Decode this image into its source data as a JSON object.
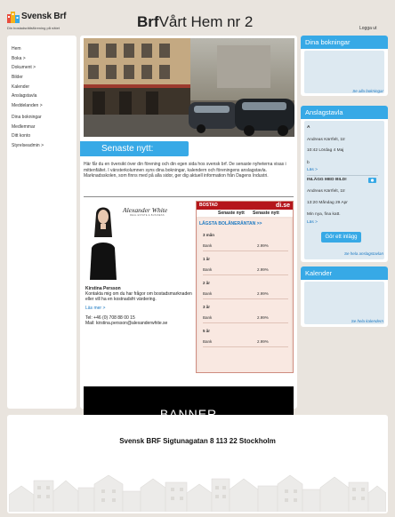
{
  "header": {
    "logo_brand": "Svensk Brf",
    "logo_tagline": "Din bostadsrättsförening på nätet",
    "site_title_bold": "Brf",
    "site_title_rest": "Vårt Hem nr 2",
    "logout": "Logga ut"
  },
  "sidebar": {
    "items": [
      {
        "label": "Hem"
      },
      {
        "label": "Boka >"
      },
      {
        "label": "Dokument >"
      },
      {
        "label": "Bilder"
      },
      {
        "label": "Kalender"
      },
      {
        "label": "Anslagstavla"
      },
      {
        "label": "Meddelanden >"
      },
      {
        "label": "Dina bokningar"
      },
      {
        "label": "Medlemmar"
      },
      {
        "label": "Ditt konto"
      },
      {
        "label": "Styrelseadmin >"
      }
    ]
  },
  "main": {
    "news_heading": "Senaste nytt:",
    "intro": "Här får du en översikt över din förening och din egen sida hos svensk brf. De senaste nyheterna visas i mittenfältet. I vänsterkolumnen syns dina bokningar, kalendern och föreningens anslagstavla. Marknadsskolen, som finns med på alla sidor, ger dig aktuell information från Dagens Industri.",
    "agent": {
      "logo": "Alexander White",
      "logo_sub": "REAL ESTATE & BUSINESS",
      "name": "Kirstina Persson",
      "description": "Kontakta mig om du har frågor om bostadsmarknaden eller vill ha en kostnadsfri värdering.",
      "more": "Läs mer >",
      "tel": "Tel: +46 (0) 708 88 00 15",
      "mail": "Mail: kirstina.persson@alexanderwhite.se"
    },
    "rates": {
      "section": "BOSTAD",
      "source": "di.se",
      "sub_left": "Senaste nytt",
      "sub_right": "Senaste nytt",
      "title": "LÄGSTA BOLÅNERÄNTAN >>",
      "groups": [
        {
          "term": "3 mån",
          "bank": "Bank",
          "rate": "2.99%"
        },
        {
          "term": "1 år",
          "bank": "Bank",
          "rate": "2.99%"
        },
        {
          "term": "2 år",
          "bank": "Bank",
          "rate": "2.99%"
        },
        {
          "term": "3 år",
          "bank": "Bank",
          "rate": "2.99%"
        },
        {
          "term": "5 år",
          "bank": "Bank",
          "rate": "2.99%"
        }
      ]
    },
    "banner": "BANNER"
  },
  "right": {
    "bookings": {
      "title": "Dina bokningar",
      "footer": "Se alla bokningar"
    },
    "board": {
      "title": "Anslagstavla",
      "post1": {
        "letter": "A",
        "author": "Andreas Kärrfelt, 1tr",
        "time": "10:42 Lördag 4 Maj",
        "letter2": "b",
        "more": "Läs >"
      },
      "post2": {
        "title": "INLÄGG MED BILD!",
        "author": "Andreas Kärrfelt, 1tr",
        "time": "13:20 Måndag 29 Apr",
        "text": "Min nya, fina katt.",
        "more": "Läs >"
      },
      "button": "Gör ett inlägg",
      "footer": "Se hela anslagstavlan"
    },
    "calendar": {
      "title": "Kalender",
      "footer": "Se hela kalendern"
    }
  },
  "footer": {
    "address": "Svensk BRF Sigtunagatan 8 113 22 Stockholm"
  },
  "colors": {
    "accent": "#37a9e6",
    "di_red": "#b5161b",
    "link": "#1a78c2"
  }
}
